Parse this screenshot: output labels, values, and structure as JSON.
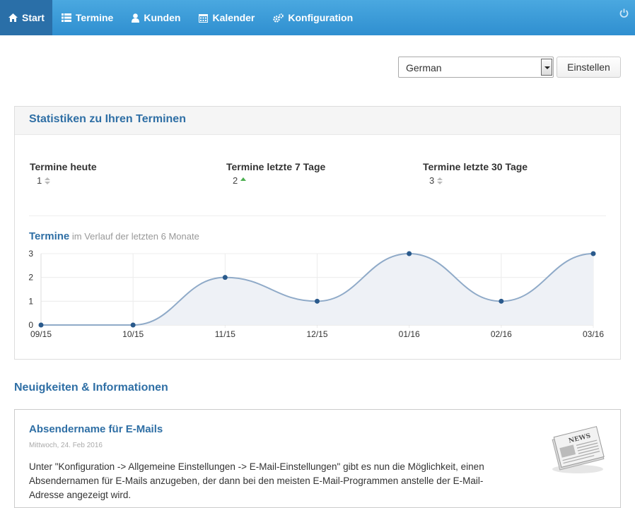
{
  "nav": {
    "items": [
      {
        "label": "Start",
        "icon": "home-icon",
        "active": true
      },
      {
        "label": "Termine",
        "icon": "list-icon"
      },
      {
        "label": "Kunden",
        "icon": "user-icon"
      },
      {
        "label": "Kalender",
        "icon": "calendar-icon"
      },
      {
        "label": "Konfiguration",
        "icon": "cogs-icon"
      }
    ],
    "logout_icon": "power-icon"
  },
  "language": {
    "selected": "German",
    "button_label": "Einstellen"
  },
  "stats": {
    "title": "Statistiken zu Ihren Terminen",
    "cards": [
      {
        "label": "Termine heute",
        "value": "1",
        "trend": "neutral"
      },
      {
        "label": "Termine letzte 7 Tage",
        "value": "2",
        "trend": "up"
      },
      {
        "label": "Termine letzte 30 Tage",
        "value": "3",
        "trend": "neutral"
      }
    ],
    "chart_title_strong": "Termine",
    "chart_title_rest": "im Verlauf der letzten 6 Monate"
  },
  "chart_data": {
    "type": "area",
    "x": [
      "09/15",
      "10/15",
      "11/15",
      "12/15",
      "01/16",
      "02/16",
      "03/16"
    ],
    "series": [
      {
        "values": [
          0,
          0,
          2,
          1,
          3,
          1,
          3
        ]
      }
    ],
    "yticks": [
      0,
      1,
      2,
      3
    ],
    "ylim": [
      0,
      3
    ],
    "grid": true,
    "colors": {
      "line": "#8faac8",
      "fill": "#eef1f6",
      "point": "#2a5a8c"
    }
  },
  "news": {
    "heading": "Neuigkeiten & Informationen",
    "items": [
      {
        "title": "Absendername für E-Mails",
        "date": "Mittwoch, 24. Feb 2016",
        "body": "Unter \"Konfiguration -> Allgemeine Einstellungen -> E-Mail-Einstellungen\" gibt es nun die Möglichkeit, einen Absendernamen für E-Mails anzugeben, der dann bei den meisten E-Mail-Programmen anstelle der E-Mail-Adresse angezeigt wird.",
        "image": "newspaper-icon",
        "image_text": "NEWS"
      }
    ]
  }
}
